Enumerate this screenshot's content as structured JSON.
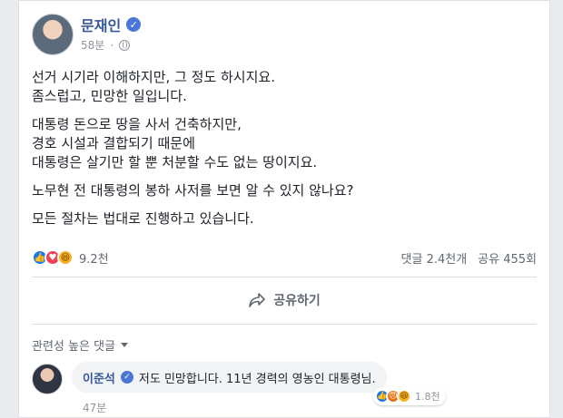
{
  "post": {
    "author": "문재인",
    "time": "58분",
    "paragraphs": [
      [
        "선거 시기라 이해하지만, 그 정도 하시지요.",
        "좀스럽고, 민망한 일입니다."
      ],
      [
        "대통령 돈으로 땅을 사서 건축하지만,",
        "경호 시설과 결합되기 때문에",
        "대통령은 살기만 할 뿐 처분할 수도 없는 땅이지요."
      ],
      [
        "노무현 전 대통령의 봉하 사저를 보면 알 수 있지 않나요?"
      ],
      [
        "모든 절차는 법대로 진행하고 있습니다."
      ]
    ],
    "reaction_count": "9.2천",
    "comment_count": "댓글 2.4천개",
    "share_count": "공유 455회",
    "share_label": "공유하기"
  },
  "comments": {
    "sort_label": "관련성 높은 댓글",
    "top": {
      "author": "이준석",
      "text": "저도 민망합니다. 11년 경력의 영농인 대통령님.",
      "reaction_count": "1.8천",
      "time": "47분"
    }
  },
  "icons": {
    "verified": "verified-check-icon",
    "privacy": "globe-icon",
    "share": "share-arrow-icon",
    "sort": "chevron-down-icon"
  },
  "colors": {
    "name_blue": "#365899",
    "meta_gray": "#90949c",
    "like_blue": "#1877f2",
    "love_red": "#f33e58",
    "haha_yellow": "#f7b125",
    "angry_orange": "#e9710f"
  }
}
